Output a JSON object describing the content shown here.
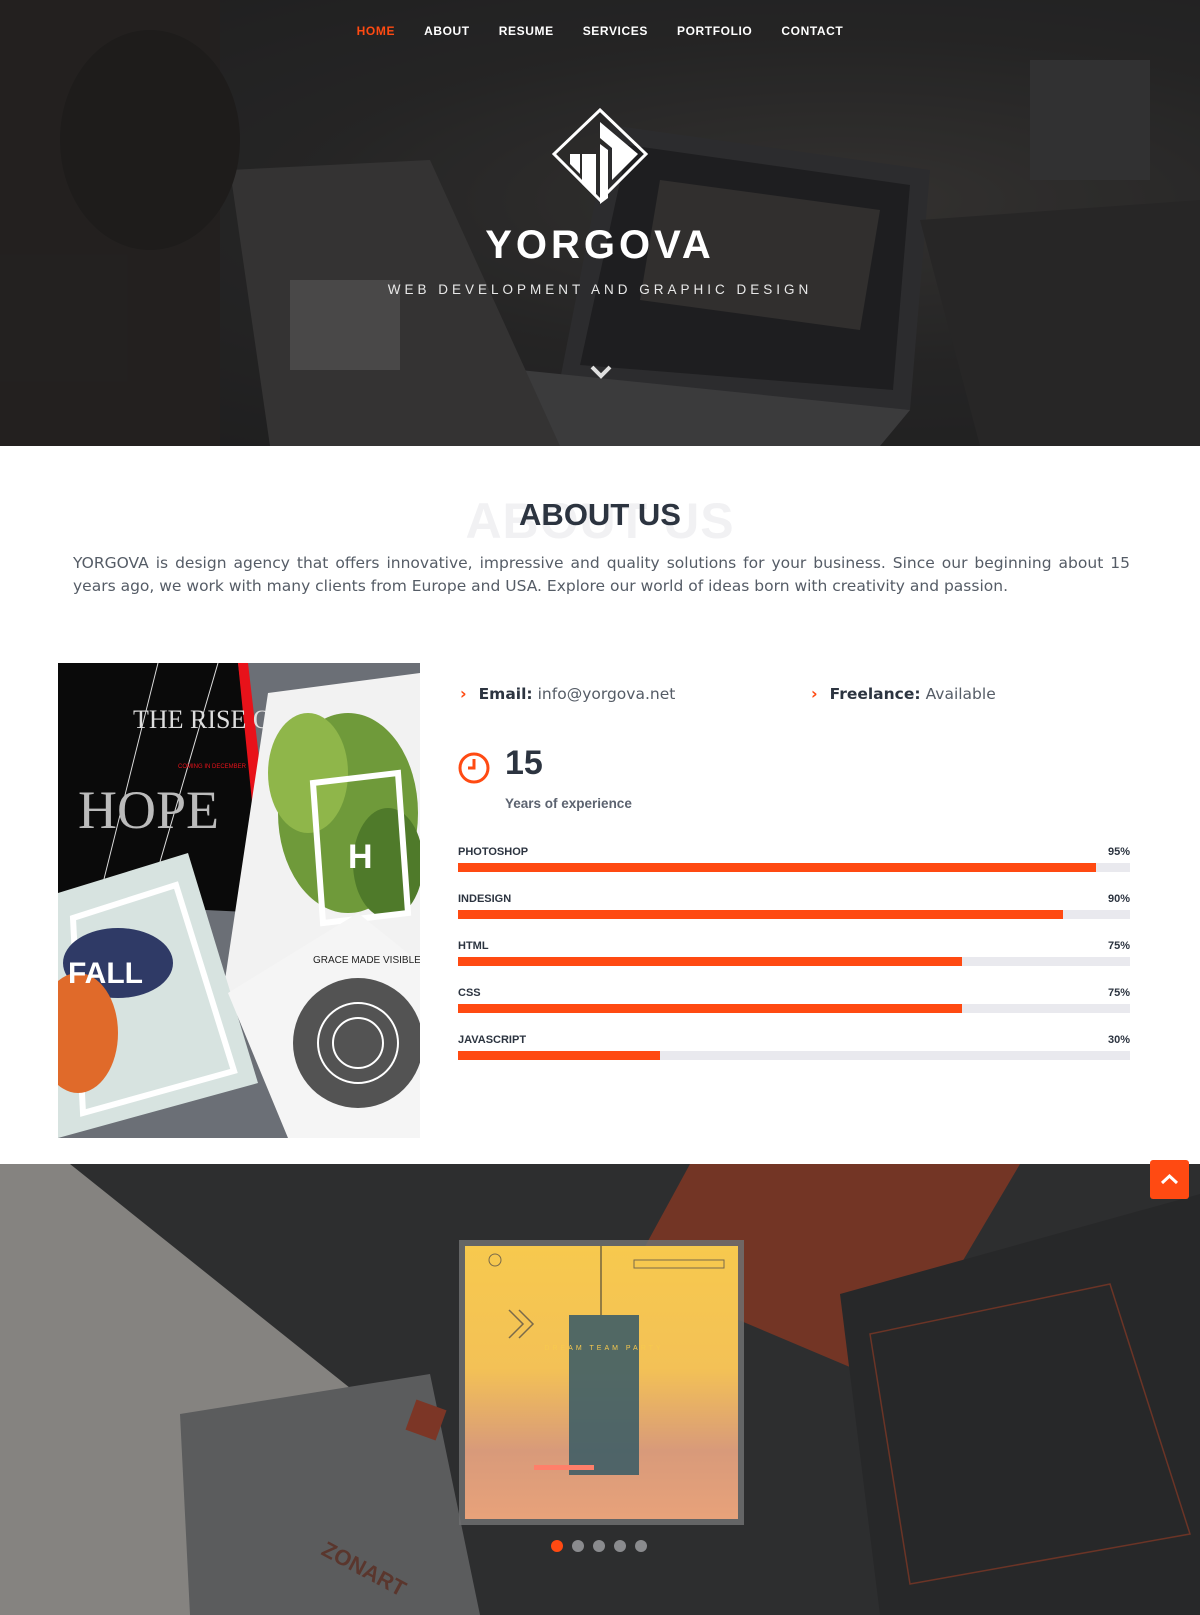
{
  "nav": {
    "items": [
      {
        "label": "HOME",
        "active": true
      },
      {
        "label": "ABOUT",
        "active": false
      },
      {
        "label": "RESUME",
        "active": false
      },
      {
        "label": "SERVICES",
        "active": false
      },
      {
        "label": "PORTFOLIO",
        "active": false
      },
      {
        "label": "CONTACT",
        "active": false
      }
    ]
  },
  "hero": {
    "brand": "YORGOVA",
    "tagline": "WEB DEVELOPMENT AND GRAPHIC DESIGN",
    "logo_icon": "yorgova-logo-icon",
    "scroll_icon": "chevron-down-icon"
  },
  "about": {
    "title": "ABOUT US",
    "title_shadow": "ABOUT US",
    "text": "YORGOVA is design agency that offers innovative, impressive and quality solutions for your business. Since our beginning about 15 years ago, we work with many clients from Europe and USA. Explore our world of ideas born with creativity and passion.",
    "email_label": "Email:",
    "email_value": "info@yorgova.net",
    "freelance_label": "Freelance:",
    "freelance_value": "Available",
    "experience_number": "15",
    "experience_label": "Years of experience",
    "collage_text": {
      "poster1": "THE RISE OF HOPE",
      "poster1_small": "COMING IN DECEMBER",
      "poster2": "H",
      "poster3": "FALL",
      "poster4": "GRACE MADE VISIBLE"
    }
  },
  "skills": [
    {
      "name": "PHOTOSHOP",
      "percent_label": "95%",
      "value": 95
    },
    {
      "name": "INDESIGN",
      "percent_label": "90%",
      "value": 90
    },
    {
      "name": "HTML",
      "percent_label": "75%",
      "value": 75
    },
    {
      "name": "CSS",
      "percent_label": "75%",
      "value": 75
    },
    {
      "name": "JAVASCRIPT",
      "percent_label": "30%",
      "value": 30
    }
  ],
  "slider": {
    "poster_text": "DREAM TEAM PARTY",
    "background_text": "ZONART",
    "dot_count": 5,
    "active_dot": 0
  },
  "colors": {
    "accent": "#ff4a12",
    "heading": "#2c3440",
    "body_text": "#555c66"
  }
}
